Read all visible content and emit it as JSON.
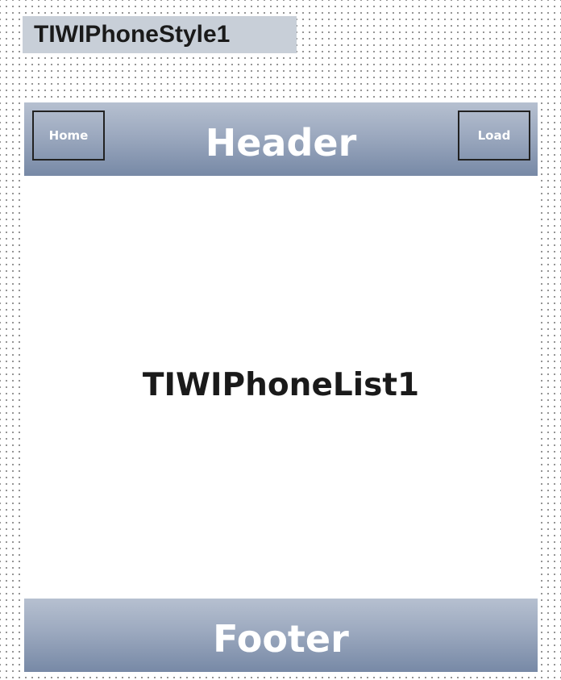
{
  "style_component": {
    "label": "TIWIPhoneStyle1"
  },
  "header": {
    "title": "Header",
    "left_button_label": "Home",
    "right_button_label": "Load"
  },
  "list": {
    "label": "TIWIPhoneList1"
  },
  "footer": {
    "title": "Footer"
  },
  "colors": {
    "bar_gradient_top": "#b6c0d0",
    "bar_gradient_bottom": "#7789a6",
    "label_background": "#c8cfd8",
    "grid_dot": "#7a7a7a"
  }
}
